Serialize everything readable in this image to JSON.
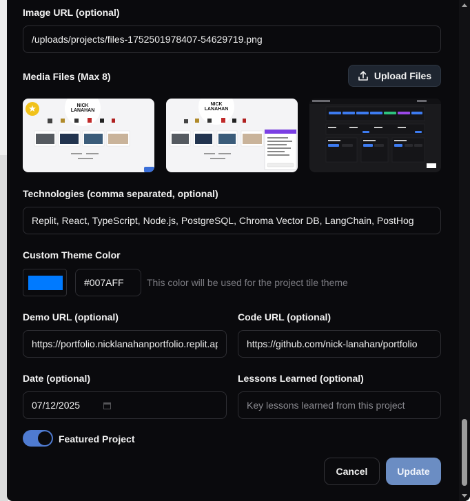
{
  "form": {
    "image_url": {
      "label": "Image URL (optional)",
      "value": "/uploads/projects/files-1752501978407-54629719.png"
    },
    "media": {
      "label": "Media Files (Max 8)",
      "upload_label": "Upload Files",
      "thumb1": {
        "title": "NICK\nLANAHAN"
      },
      "thumb2": {
        "title": "NICK\nLANAHAN"
      }
    },
    "technologies": {
      "label": "Technologies (comma separated, optional)",
      "value": "Replit, React, TypeScript, Node.js, PostgreSQL, Chroma Vector DB, LangChain, PostHog"
    },
    "theme": {
      "label": "Custom Theme Color",
      "hex": "#007AFF",
      "hint": "This color will be used for the project tile theme",
      "color": "#007AFF"
    },
    "demo_url": {
      "label": "Demo URL (optional)",
      "value": "https://portfolio.nicklanahanportfolio.replit.app"
    },
    "code_url": {
      "label": "Code URL (optional)",
      "value": "https://github.com/nick-lanahan/portfolio"
    },
    "date": {
      "label": "Date (optional)",
      "value": "07/12/2025"
    },
    "lessons": {
      "label": "Lessons Learned (optional)",
      "placeholder": "Key lessons learned from this project"
    },
    "featured": {
      "label": "Featured Project",
      "on": true
    }
  },
  "actions": {
    "cancel": "Cancel",
    "update": "Update"
  }
}
